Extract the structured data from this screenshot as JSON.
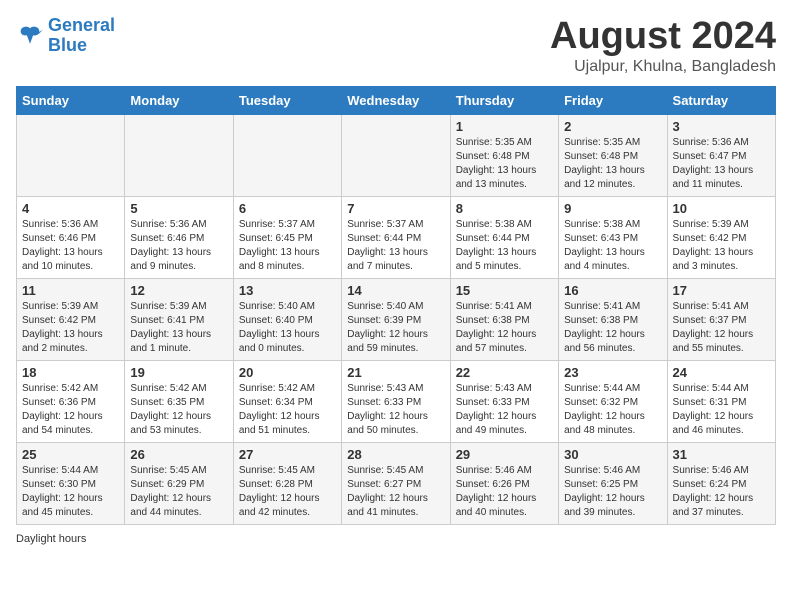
{
  "logo": {
    "line1": "General",
    "line2": "Blue"
  },
  "title": "August 2024",
  "subtitle": "Ujalpur, Khulna, Bangladesh",
  "days_of_week": [
    "Sunday",
    "Monday",
    "Tuesday",
    "Wednesday",
    "Thursday",
    "Friday",
    "Saturday"
  ],
  "weeks": [
    [
      {
        "day": "",
        "info": ""
      },
      {
        "day": "",
        "info": ""
      },
      {
        "day": "",
        "info": ""
      },
      {
        "day": "",
        "info": ""
      },
      {
        "day": "1",
        "info": "Sunrise: 5:35 AM\nSunset: 6:48 PM\nDaylight: 13 hours\nand 13 minutes."
      },
      {
        "day": "2",
        "info": "Sunrise: 5:35 AM\nSunset: 6:48 PM\nDaylight: 13 hours\nand 12 minutes."
      },
      {
        "day": "3",
        "info": "Sunrise: 5:36 AM\nSunset: 6:47 PM\nDaylight: 13 hours\nand 11 minutes."
      }
    ],
    [
      {
        "day": "4",
        "info": "Sunrise: 5:36 AM\nSunset: 6:46 PM\nDaylight: 13 hours\nand 10 minutes."
      },
      {
        "day": "5",
        "info": "Sunrise: 5:36 AM\nSunset: 6:46 PM\nDaylight: 13 hours\nand 9 minutes."
      },
      {
        "day": "6",
        "info": "Sunrise: 5:37 AM\nSunset: 6:45 PM\nDaylight: 13 hours\nand 8 minutes."
      },
      {
        "day": "7",
        "info": "Sunrise: 5:37 AM\nSunset: 6:44 PM\nDaylight: 13 hours\nand 7 minutes."
      },
      {
        "day": "8",
        "info": "Sunrise: 5:38 AM\nSunset: 6:44 PM\nDaylight: 13 hours\nand 5 minutes."
      },
      {
        "day": "9",
        "info": "Sunrise: 5:38 AM\nSunset: 6:43 PM\nDaylight: 13 hours\nand 4 minutes."
      },
      {
        "day": "10",
        "info": "Sunrise: 5:39 AM\nSunset: 6:42 PM\nDaylight: 13 hours\nand 3 minutes."
      }
    ],
    [
      {
        "day": "11",
        "info": "Sunrise: 5:39 AM\nSunset: 6:42 PM\nDaylight: 13 hours\nand 2 minutes."
      },
      {
        "day": "12",
        "info": "Sunrise: 5:39 AM\nSunset: 6:41 PM\nDaylight: 13 hours\nand 1 minute."
      },
      {
        "day": "13",
        "info": "Sunrise: 5:40 AM\nSunset: 6:40 PM\nDaylight: 13 hours\nand 0 minutes."
      },
      {
        "day": "14",
        "info": "Sunrise: 5:40 AM\nSunset: 6:39 PM\nDaylight: 12 hours\nand 59 minutes."
      },
      {
        "day": "15",
        "info": "Sunrise: 5:41 AM\nSunset: 6:38 PM\nDaylight: 12 hours\nand 57 minutes."
      },
      {
        "day": "16",
        "info": "Sunrise: 5:41 AM\nSunset: 6:38 PM\nDaylight: 12 hours\nand 56 minutes."
      },
      {
        "day": "17",
        "info": "Sunrise: 5:41 AM\nSunset: 6:37 PM\nDaylight: 12 hours\nand 55 minutes."
      }
    ],
    [
      {
        "day": "18",
        "info": "Sunrise: 5:42 AM\nSunset: 6:36 PM\nDaylight: 12 hours\nand 54 minutes."
      },
      {
        "day": "19",
        "info": "Sunrise: 5:42 AM\nSunset: 6:35 PM\nDaylight: 12 hours\nand 53 minutes."
      },
      {
        "day": "20",
        "info": "Sunrise: 5:42 AM\nSunset: 6:34 PM\nDaylight: 12 hours\nand 51 minutes."
      },
      {
        "day": "21",
        "info": "Sunrise: 5:43 AM\nSunset: 6:33 PM\nDaylight: 12 hours\nand 50 minutes."
      },
      {
        "day": "22",
        "info": "Sunrise: 5:43 AM\nSunset: 6:33 PM\nDaylight: 12 hours\nand 49 minutes."
      },
      {
        "day": "23",
        "info": "Sunrise: 5:44 AM\nSunset: 6:32 PM\nDaylight: 12 hours\nand 48 minutes."
      },
      {
        "day": "24",
        "info": "Sunrise: 5:44 AM\nSunset: 6:31 PM\nDaylight: 12 hours\nand 46 minutes."
      }
    ],
    [
      {
        "day": "25",
        "info": "Sunrise: 5:44 AM\nSunset: 6:30 PM\nDaylight: 12 hours\nand 45 minutes."
      },
      {
        "day": "26",
        "info": "Sunrise: 5:45 AM\nSunset: 6:29 PM\nDaylight: 12 hours\nand 44 minutes."
      },
      {
        "day": "27",
        "info": "Sunrise: 5:45 AM\nSunset: 6:28 PM\nDaylight: 12 hours\nand 42 minutes."
      },
      {
        "day": "28",
        "info": "Sunrise: 5:45 AM\nSunset: 6:27 PM\nDaylight: 12 hours\nand 41 minutes."
      },
      {
        "day": "29",
        "info": "Sunrise: 5:46 AM\nSunset: 6:26 PM\nDaylight: 12 hours\nand 40 minutes."
      },
      {
        "day": "30",
        "info": "Sunrise: 5:46 AM\nSunset: 6:25 PM\nDaylight: 12 hours\nand 39 minutes."
      },
      {
        "day": "31",
        "info": "Sunrise: 5:46 AM\nSunset: 6:24 PM\nDaylight: 12 hours\nand 37 minutes."
      }
    ]
  ],
  "legend_label": "Daylight hours"
}
